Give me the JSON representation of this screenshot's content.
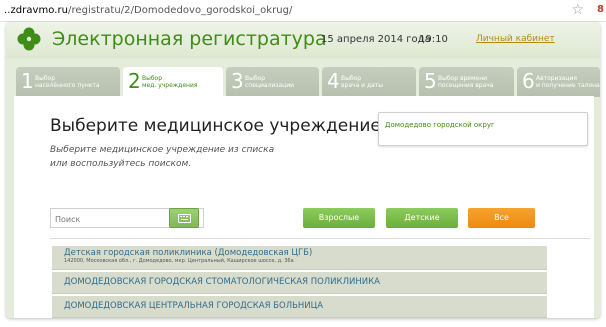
{
  "browser": {
    "url_host": "..zdravmo.ru",
    "url_path": "/registratu/2/Domodedovo_gorodskoi_okrug/"
  },
  "header": {
    "title": "Электронная регистратура",
    "date": "15 апреля 2014 года",
    "time": "19:10",
    "cabinet_link": "Личный кабинет",
    "logo_icon": "clover-icon",
    "accent_color": "#3f8d17"
  },
  "steps": [
    {
      "num": "1",
      "line1": "Выбор",
      "line2": "населённого пункта",
      "active": false
    },
    {
      "num": "2",
      "line1": "Выбор",
      "line2": "мед. учреждения",
      "active": true
    },
    {
      "num": "3",
      "line1": "Выбор",
      "line2": "специализации",
      "active": false
    },
    {
      "num": "4",
      "line1": "Выбор",
      "line2": "врача и даты",
      "active": false
    },
    {
      "num": "5",
      "line1": "Выбор времени",
      "line2": "посещения врача",
      "active": false
    },
    {
      "num": "6",
      "line1": "Авторизация",
      "line2": "и получение талона",
      "active": false
    }
  ],
  "main": {
    "heading": "Выберите медицинское учреждение",
    "hint_line1": "Выберите медицинское учреждение из списка",
    "hint_line2": "или воспользуйтесь поиском.",
    "region": "Домодедово городской округ",
    "search_placeholder": "Поиск",
    "search_icon": "keyboard-icon",
    "filters": {
      "adult": "Взрослые",
      "children": "Детские",
      "all": "Все"
    },
    "items": [
      {
        "name": "Детская городская поликлиника (Домодедовская ЦГБ)",
        "address": "142000, Московская обл., г. Домодедово, мкр. Центральный, Каширское шоссе, д. 36а"
      },
      {
        "name": "ДОМОДЕДОВСКАЯ ГОРОДСКАЯ СТОМАТОЛОГИЧЕСКАЯ ПОЛИКЛИНИКА"
      },
      {
        "name": "ДОМОДЕДОВСКАЯ ЦЕНТРАЛЬНАЯ ГОРОДСКАЯ БОЛЬНИЦА"
      }
    ]
  }
}
